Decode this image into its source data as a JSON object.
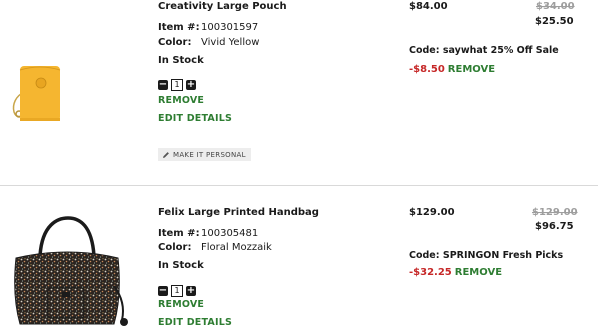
{
  "cart_items": [
    {
      "name": "Creativity Large Pouch",
      "item_label": "Item #:",
      "item_number": "100301597",
      "color_label": "Color:",
      "color": "Vivid Yellow",
      "stock": "In Stock",
      "quantity": "1",
      "remove_label": "REMOVE",
      "edit_label": "EDIT DETAILS",
      "personalize_label": "MAKE IT PERSONAL",
      "price": "$84.00",
      "original_price": "$34.00",
      "sale_price": "$25.50",
      "promo_code": "Code: saywhat 25% Off Sale",
      "discount": "-$8.50",
      "promo_remove_label": "REMOVE"
    },
    {
      "name": "Felix Large Printed Handbag",
      "item_label": "Item #:",
      "item_number": "100305481",
      "color_label": "Color:",
      "color": "Floral Mozzaik",
      "stock": "In Stock",
      "quantity": "1",
      "remove_label": "REMOVE",
      "edit_label": "EDIT DETAILS",
      "price": "$129.00",
      "original_price": "$129.00",
      "sale_price": "$96.75",
      "promo_code": "Code: SPRINGON Fresh Picks",
      "discount": "-$32.25",
      "promo_remove_label": "REMOVE"
    }
  ],
  "colors": {
    "link_green": "#2e7d32",
    "discount_red": "#c62828",
    "strike_gray": "#9e9e9e",
    "pouch_yellow": "#f5b630"
  },
  "icons": {
    "decrease": "minus-icon",
    "increase": "plus-icon",
    "personalize": "pencil-icon"
  }
}
